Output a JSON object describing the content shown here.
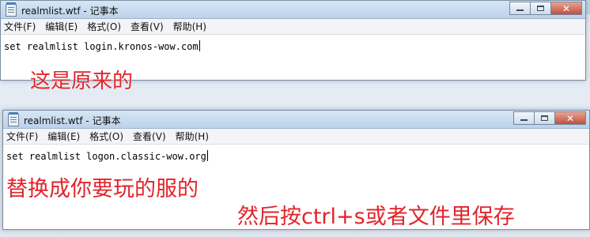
{
  "window1": {
    "title": "realmlist.wtf - 记事本",
    "menu": [
      "文件(F)",
      "编辑(E)",
      "格式(O)",
      "查看(V)",
      "帮助(H)"
    ],
    "content": "set realmlist login.kronos-wow.com",
    "annotation": "这是原来的"
  },
  "window2": {
    "title": "realmlist.wtf - 记事本",
    "menu": [
      "文件(F)",
      "编辑(E)",
      "格式(O)",
      "查看(V)",
      "帮助(H)"
    ],
    "content": "set realmlist logon.classic-wow.org",
    "annotation1": "替换成你要玩的服的",
    "annotation2": "然后按ctrl+s或者文件里保存"
  },
  "colors": {
    "annotation": "#e1242b",
    "titlebar": "#c6d9ee"
  },
  "icons": {
    "app": "notepad-icon",
    "minimize": "minimize-icon",
    "maximize": "maximize-icon",
    "close": "close-icon"
  }
}
